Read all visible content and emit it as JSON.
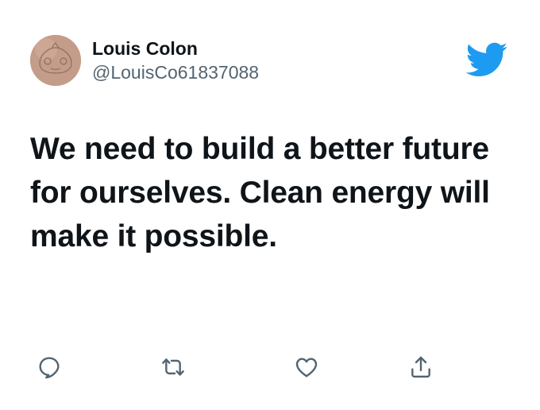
{
  "tweet": {
    "author": {
      "display_name": "Louis Colon",
      "handle": "@LouisCo61837088",
      "avatar_icon": "cartoon-face-avatar"
    },
    "text": "We need to build a better future for ourselves. Clean energy will make it possible.",
    "brand_icon": "twitter-bird-icon"
  },
  "actions": [
    {
      "name": "reply",
      "icon": "reply-icon"
    },
    {
      "name": "retweet",
      "icon": "retweet-icon"
    },
    {
      "name": "like",
      "icon": "heart-icon"
    },
    {
      "name": "share",
      "icon": "share-icon"
    }
  ],
  "colors": {
    "text_primary": "#0f1419",
    "text_secondary": "#536471",
    "twitter_blue": "#1d9bf0",
    "avatar_bg": "#c49c8a"
  }
}
